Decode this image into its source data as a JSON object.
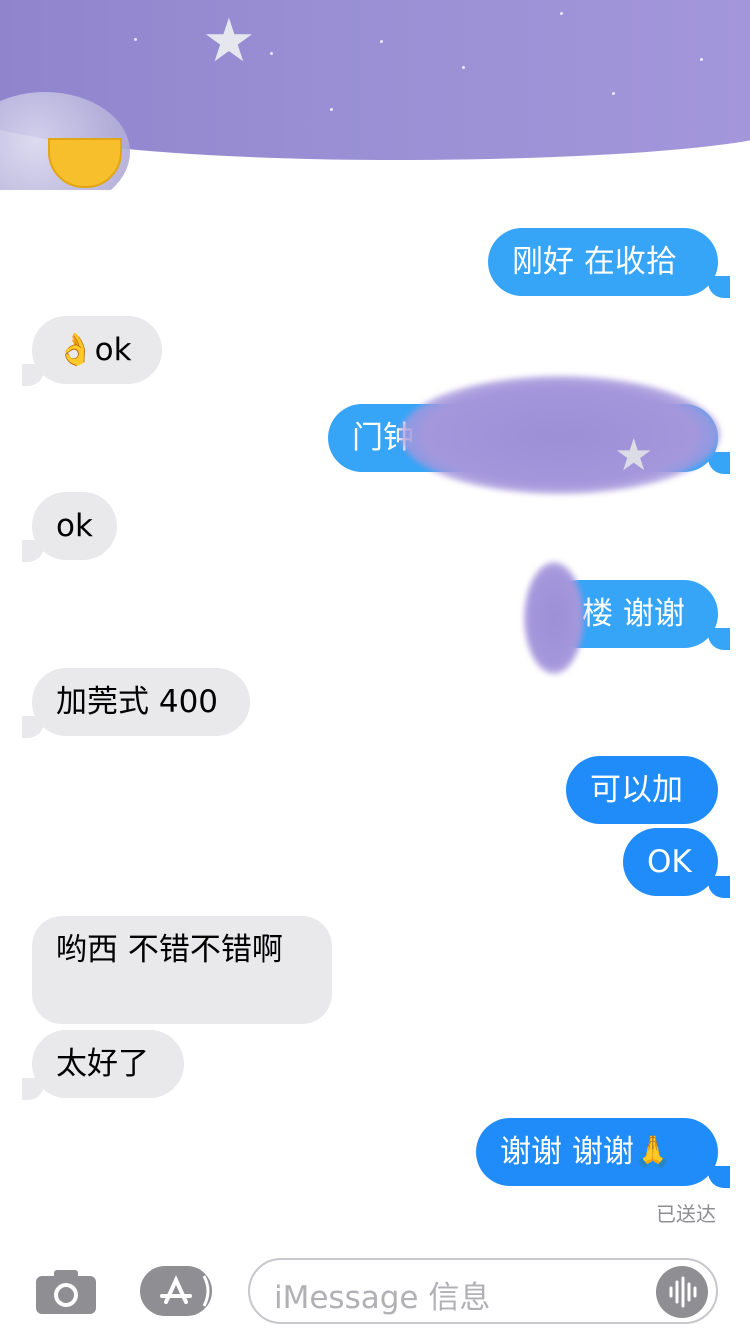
{
  "messages": [
    {
      "text": "刚好 在收拾",
      "dir": "sent"
    },
    {
      "text": "ok",
      "emoji": "👌",
      "dir": "received"
    },
    {
      "text": "门钟",
      "dir": "sent",
      "redacted": true
    },
    {
      "text": "ok",
      "dir": "received"
    },
    {
      "text": "楼 谢谢",
      "dir": "sent",
      "redacted": true
    },
    {
      "text": "加莞式 400",
      "dir": "received"
    },
    {
      "text": "可以加",
      "dir": "sent"
    },
    {
      "text": "OK",
      "dir": "sent"
    },
    {
      "text": "哟西 不错不错啊",
      "dir": "received"
    },
    {
      "text": "太好了",
      "dir": "received"
    },
    {
      "text": "谢谢 谢谢",
      "emoji": "🙏",
      "dir": "sent"
    }
  ],
  "status": "已送达",
  "composer": {
    "placeholder": "iMessage 信息"
  },
  "colors": {
    "sent": "#1f8cf9",
    "received": "#e9e9eb",
    "banner": "#9a8fd4"
  },
  "icons": [
    "camera-icon",
    "app-store-icon",
    "audio-wave-icon",
    "star-icon"
  ]
}
